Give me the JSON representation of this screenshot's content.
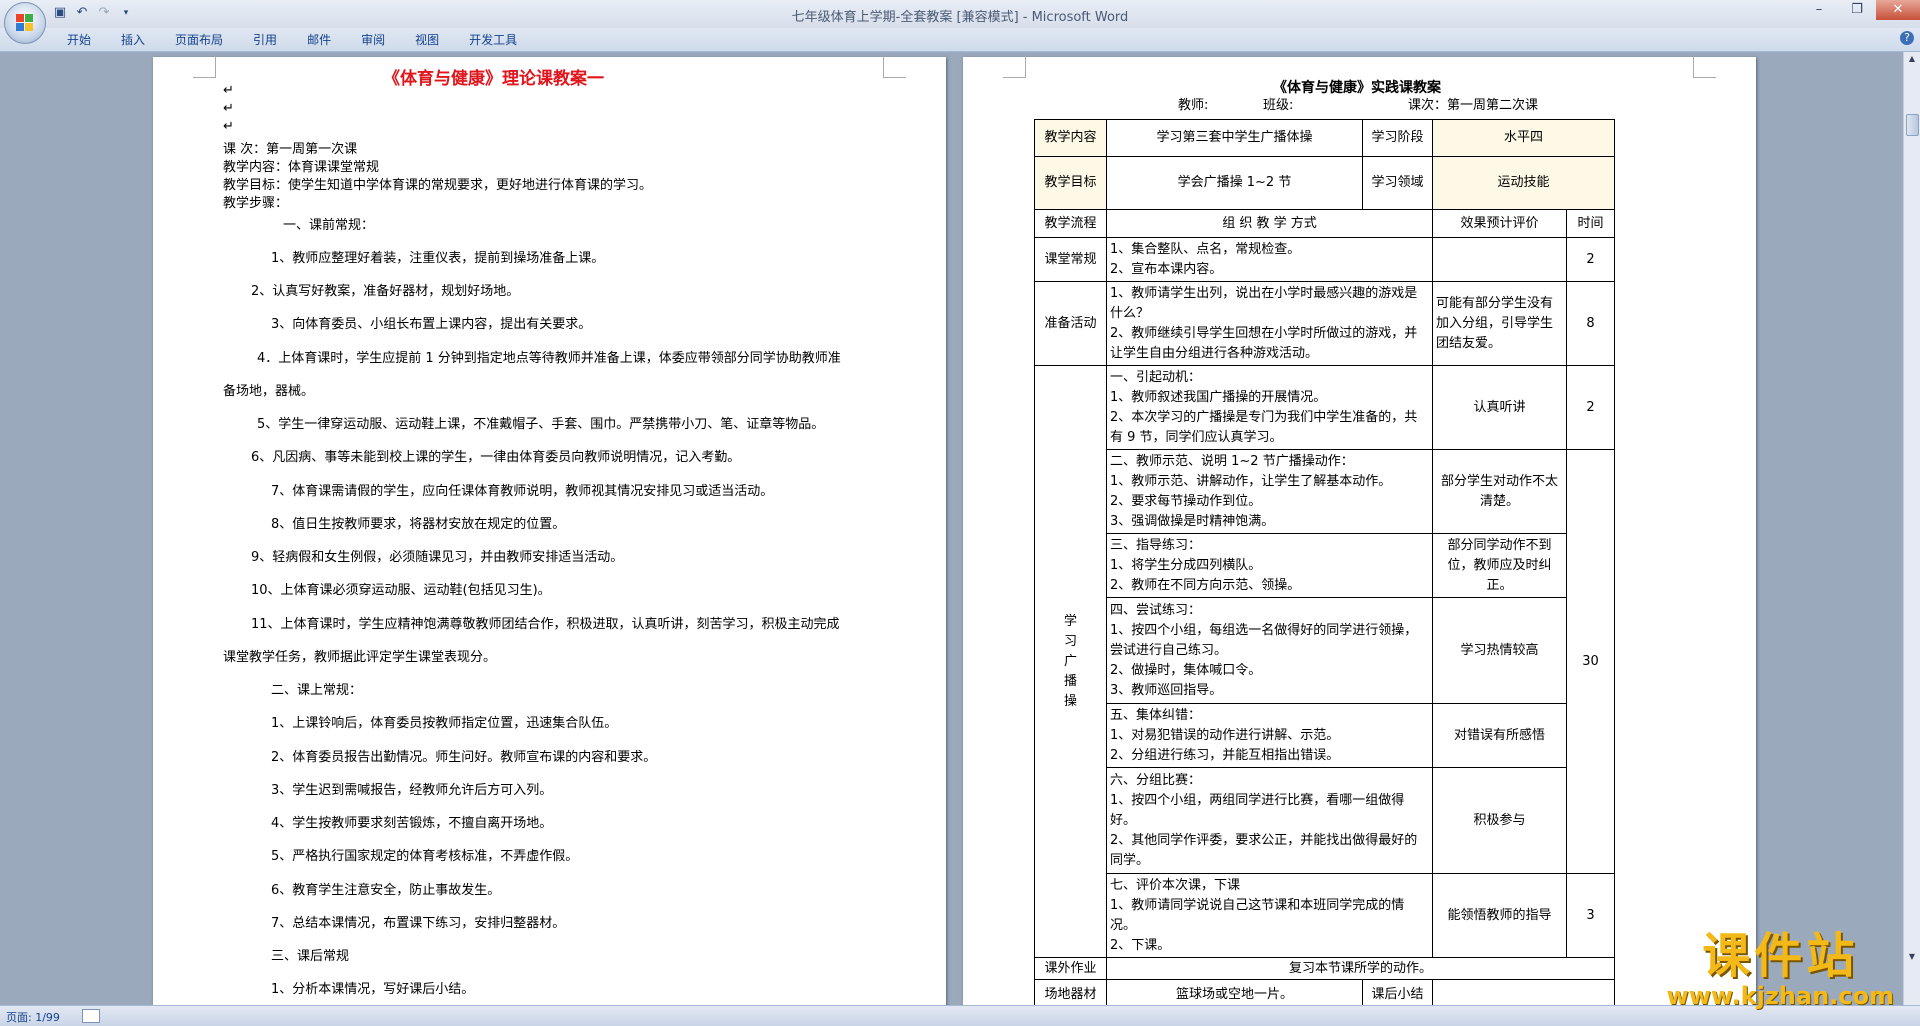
{
  "window": {
    "title": "七年级体育上学期-全套教案 [兼容模式] - Microsoft Word",
    "qat_icons": [
      "save-icon",
      "undo-icon",
      "redo-icon",
      "customize-icon"
    ]
  },
  "ribbon": {
    "tabs": [
      "开始",
      "插入",
      "页面布局",
      "引用",
      "邮件",
      "审阅",
      "视图",
      "开发工具"
    ],
    "help": "?"
  },
  "status": {
    "page": "页面: 1/99"
  },
  "watermark": {
    "text": "课件站",
    "url": "www.kjzhan.com"
  },
  "page1": {
    "title": "《体育与健康》理论课教案一",
    "lines": [
      "课      次：第一周第一次课",
      "教学内容：体育课课堂常规",
      "教学目标：使学生知道中学体育课的常规要求，更好地进行体育课的学习。",
      "教学步骤：",
      "一、课前常规：",
      "1、教师应整理好着装，注重仪表，提前到操场准备上课。",
      "2、认真写好教案，准备好器材，规划好场地。",
      "3、向体育委员、小组长布置上课内容，提出有关要求。",
      "4．上体育课时，学生应提前 1 分钟到指定地点等待教师并准备上课，体委应带领部分同学协助教师准",
      "备场地，器械。",
      "5、学生一律穿运动服、运动鞋上课，不准戴帽子、手套、围巾。严禁携带小刀、笔、证章等物品。",
      "6、凡因病、事等未能到校上课的学生，一律由体育委员向教师说明情况，记入考勤。",
      "7、体育课需请假的学生，应向任课体育教师说明，教师视其情况安排见习或适当活动。",
      "8、值日生按教师要求，将器材安放在规定的位置。",
      "9、轻病假和女生例假，必须随课见习，并由教师安排适当活动。",
      "10、上体育课必须穿运动服、运动鞋(包括见习生)。",
      "11、上体育课时，学生应精神饱满尊敬教师团结合作，积极进取，认真听讲，刻苦学习，积极主动完成",
      "课堂教学任务，教师据此评定学生课堂表现分。",
      "二、课上常规：",
      "1、上课铃响后，体育委员按教师指定位置，迅速集合队伍。",
      "2、体育委员报告出勤情况。师生问好。教师宣布课的内容和要求。",
      "3、学生迟到需喊报告，经教师允许后方可入列。",
      "4、学生按教师要求刻苦锻炼，不擅自离开场地。",
      "5、严格执行国家规定的体育考核标准，不弄虚作假。",
      "6、教育学生注意安全，防止事故发生。",
      "7、总结本课情况，布置课下练习，安排归整器材。",
      "三、课后常规",
      "1、分析本课情况，写好课后小结。"
    ]
  },
  "page2": {
    "title": "《体育与健康》实践课教案",
    "teacher": "教师:",
    "class": "班级:",
    "lesson": "课次：第一周第二次课",
    "table": {
      "r1": [
        "教学内容",
        "学习第三套中学生广播体操",
        "学习阶段",
        "水平四"
      ],
      "r2": [
        "教学目标",
        "学会广播操 1~2 节",
        "学习领域",
        "运动技能"
      ],
      "header": [
        "教学流程",
        "组 织 教 学 方式",
        "效果预计评价",
        "时间"
      ],
      "kt": {
        "label": "课堂常规",
        "content": [
          "1、集合整队、点名，常规检查。",
          "2、宣布本课内容。"
        ],
        "eval": "",
        "time": "2"
      },
      "zb": {
        "label": "准备活动",
        "content": [
          "1、教师请学生出列，说出在小学时最感兴趣的游戏是什么？",
          "2、教师继续引导学生回想在小学时所做过的游戏，并让学生自由分组进行各种游戏活动。"
        ],
        "eval": "可能有部分学生没有加入分组，引导学生团结友爱。",
        "time": "8"
      },
      "xx_label": [
        "学",
        "习",
        "广",
        "播",
        "操"
      ],
      "xx": [
        {
          "content": [
            "一、引起动机：",
            "1、教师叙述我国广播操的开展情况。",
            "2、本次学习的广播操是专门为我们中学生准备的，共有 9 节，同学们应认真学习。"
          ],
          "eval": "认真听讲",
          "time": "2"
        },
        {
          "content": [
            "二、教师示范、说明 1~2 节广播操动作：",
            "1、教师示范、讲解动作，让学生了解基本动作。",
            "2、要求每节操动作到位。",
            "3、强调做操是时精神饱满。"
          ],
          "eval": "部分学生对动作不太清楚。",
          "time": "30"
        },
        {
          "content": [
            "三、指导练习：",
            "1、将学生分成四列横队。",
            "2、教师在不同方向示范、领操。"
          ],
          "eval": "部分同学动作不到位，教师应及时纠正。"
        },
        {
          "content": [
            "四、尝试练习：",
            "1、按四个小组，每组选一名做得好的同学进行领操，尝试进行自己练习。",
            "2、做操时，集体喊口令。",
            "3、教师巡回指导。"
          ],
          "eval": "学习热情较高"
        },
        {
          "content": [
            "五、集体纠错：",
            "1、对易犯错误的动作进行讲解、示范。",
            "2、分组进行练习，并能互相指出错误。"
          ],
          "eval": "对错误有所感悟"
        },
        {
          "content": [
            "六、分组比赛：",
            "1、按四个小组，两组同学进行比赛，看哪一组做得好。",
            "2、其他同学作评委，要求公正，并能找出做得最好的同学。"
          ],
          "eval": "积极参与"
        },
        {
          "content": [
            "七、评价本次课，下课",
            "1、教师请同学说说自己这节课和本班同学完成的情况。",
            "2、下课。"
          ],
          "eval": "能领悟教师的指导",
          "time": "3"
        }
      ],
      "kw": [
        "课外作业",
        "复习本节课所学的动作。"
      ],
      "cd": [
        "场地器材",
        "篮球场或空地一片。",
        "课后小结",
        ""
      ]
    }
  }
}
